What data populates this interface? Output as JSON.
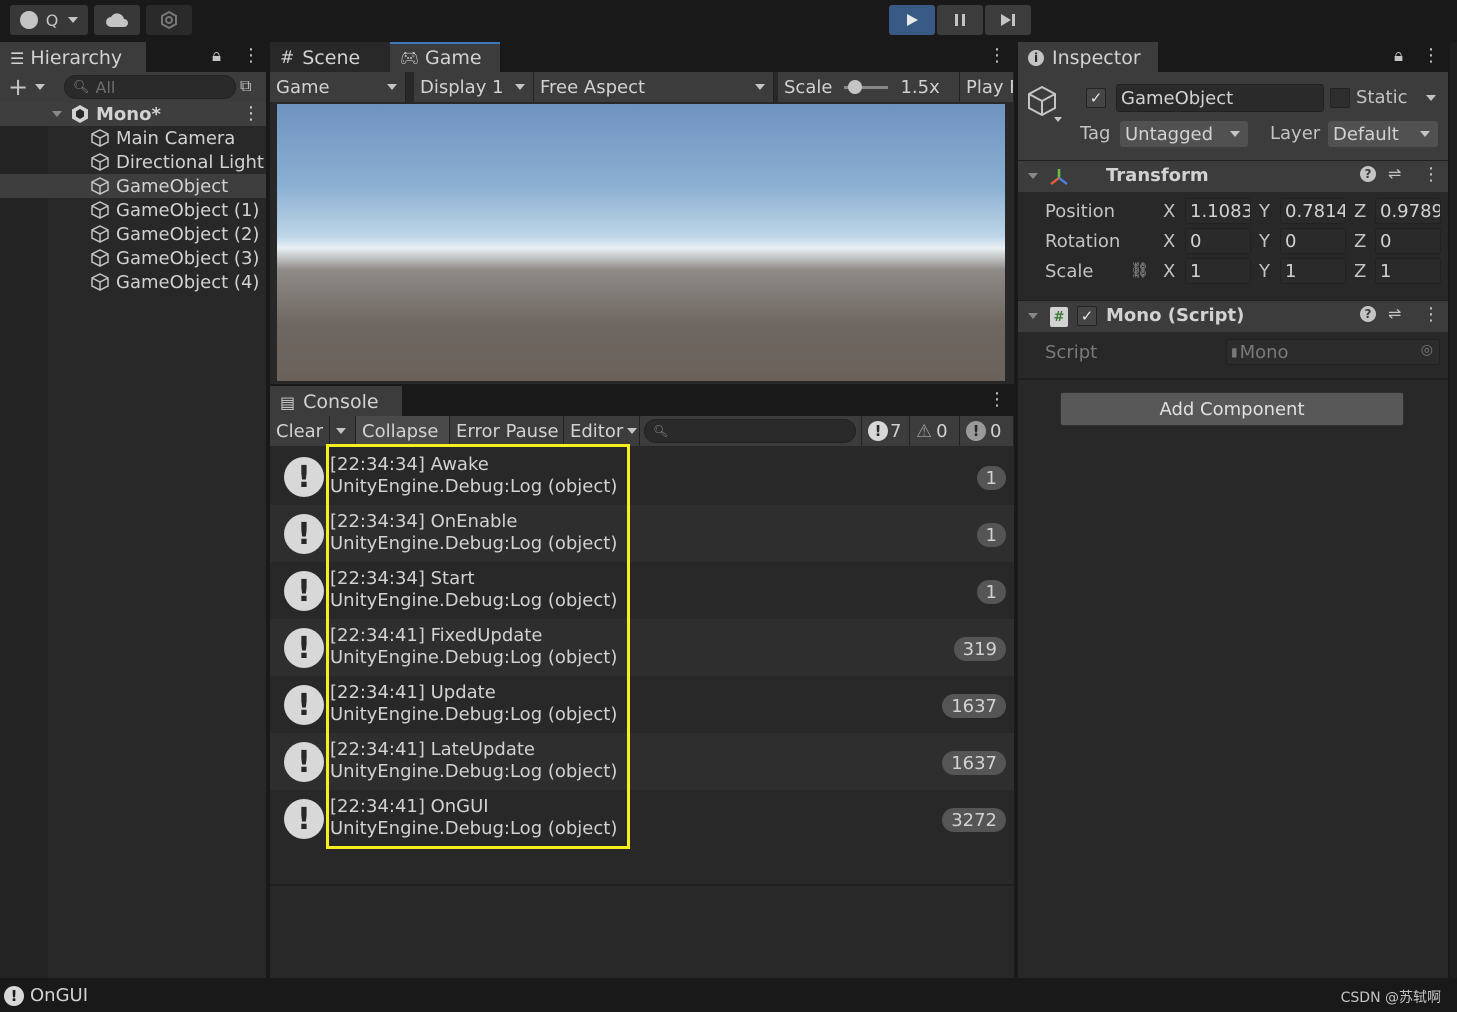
{
  "toolbar": {
    "account_label": "Q",
    "play_icon": "play-icon",
    "pause_icon": "pause-icon",
    "step_icon": "step-icon"
  },
  "hierarchy": {
    "tab_label": "Hierarchy",
    "search_placeholder": "All",
    "scene_name": "Mono*",
    "items": [
      {
        "label": "Main Camera"
      },
      {
        "label": "Directional Light"
      },
      {
        "label": "GameObject"
      },
      {
        "label": "GameObject (1)"
      },
      {
        "label": "GameObject (2)"
      },
      {
        "label": "GameObject (3)"
      },
      {
        "label": "GameObject (4)"
      }
    ]
  },
  "gameview": {
    "tabs": [
      {
        "label": "Scene"
      },
      {
        "label": "Game"
      }
    ],
    "display_mode": "Game",
    "display": "Display 1",
    "aspect": "Free Aspect",
    "scale_label": "Scale",
    "scale_value": "1.5x",
    "play_label": "Play F"
  },
  "console": {
    "tab_label": "Console",
    "clear_label": "Clear",
    "collapse_label": "Collapse",
    "error_pause_label": "Error Pause",
    "editor_label": "Editor",
    "info_count": "7",
    "warn_count": "0",
    "error_count": "0",
    "logs": [
      {
        "line1": "[22:34:34] Awake",
        "line2": "UnityEngine.Debug:Log (object)",
        "count": "1"
      },
      {
        "line1": "[22:34:34] OnEnable",
        "line2": "UnityEngine.Debug:Log (object)",
        "count": "1"
      },
      {
        "line1": "[22:34:34] Start",
        "line2": "UnityEngine.Debug:Log (object)",
        "count": "1"
      },
      {
        "line1": "[22:34:41] FixedUpdate",
        "line2": "UnityEngine.Debug:Log (object)",
        "count": "319"
      },
      {
        "line1": "[22:34:41] Update",
        "line2": "UnityEngine.Debug:Log (object)",
        "count": "1637"
      },
      {
        "line1": "[22:34:41] LateUpdate",
        "line2": "UnityEngine.Debug:Log (object)",
        "count": "1637"
      },
      {
        "line1": "[22:34:41] OnGUI",
        "line2": "UnityEngine.Debug:Log (object)",
        "count": "3272"
      }
    ]
  },
  "inspector": {
    "tab_label": "Inspector",
    "object_name": "GameObject",
    "static_label": "Static",
    "tag_label": "Tag",
    "tag_value": "Untagged",
    "layer_label": "Layer",
    "layer_value": "Default",
    "transform": {
      "title": "Transform",
      "position_label": "Position",
      "rotation_label": "Rotation",
      "scale_label": "Scale",
      "x_label": "X",
      "y_label": "Y",
      "z_label": "Z",
      "position": {
        "x": "1.1083",
        "y": "0.7814",
        "z": "0.9789"
      },
      "rotation": {
        "x": "0",
        "y": "0",
        "z": "0"
      },
      "scale": {
        "x": "1",
        "y": "1",
        "z": "1"
      }
    },
    "script_component": {
      "title": "Mono (Script)",
      "script_label": "Script",
      "script_value": "Mono"
    },
    "add_component_label": "Add Component"
  },
  "status": {
    "message": "OnGUI",
    "watermark": "CSDN @苏轼啊"
  }
}
